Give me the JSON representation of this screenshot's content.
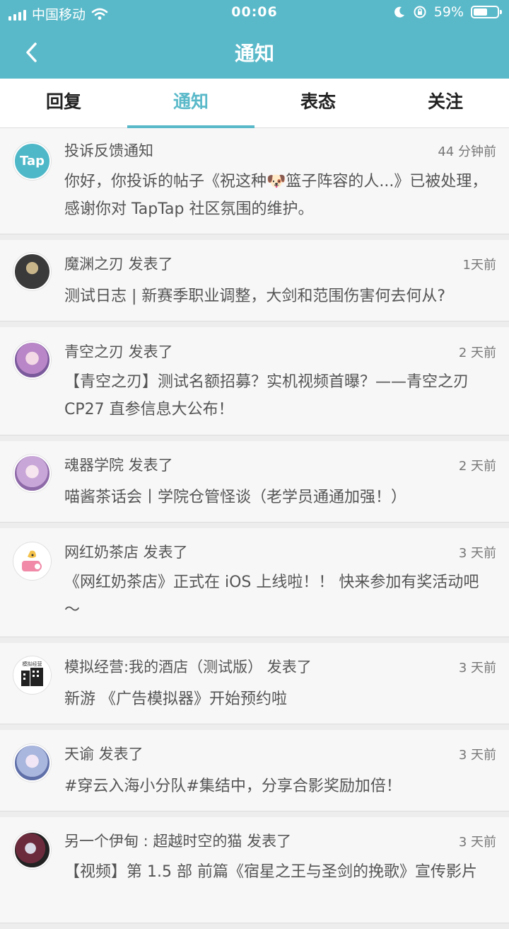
{
  "status": {
    "carrier": "中国移动",
    "time": "00:06",
    "battery": "59%",
    "battery_level": 0.59
  },
  "header": {
    "title": "通知"
  },
  "tabs": [
    {
      "label": "回复"
    },
    {
      "label": "通知"
    },
    {
      "label": "表态"
    },
    {
      "label": "关注"
    }
  ],
  "notifications": [
    {
      "sender": "投诉反馈通知",
      "time": "44 分钟前",
      "body": "你好，你投诉的帖子《祝这种🐶篮子阵容的人...》已被处理，感谢你对 TapTap 社区氛围的维护。",
      "avatar_text": "Tap"
    },
    {
      "sender": "魔渊之刃 发表了",
      "time": "1天前",
      "body": "测试日志 | 新赛季职业调整，大剑和范围伤害何去何从?"
    },
    {
      "sender": "青空之刃 发表了",
      "time": "2 天前",
      "body": "【青空之刃】测试名额招募？实机视频首曝？——青空之刃 CP27 直参信息大公布！"
    },
    {
      "sender": "魂器学院 发表了",
      "time": "2 天前",
      "body": "喵酱茶话会丨学院仓管怪谈（老学员通通加强！）"
    },
    {
      "sender": "网红奶茶店 发表了",
      "time": "3 天前",
      "body": "《网红奶茶店》正式在 iOS 上线啦！！ 快来参加有奖活动吧～"
    },
    {
      "sender": "模拟经营:我的酒店（测试版） 发表了",
      "time": "3 天前",
      "body": "新游 《广告模拟器》开始预约啦",
      "avatar_text": "模拟经营"
    },
    {
      "sender": "天谕 发表了",
      "time": "3 天前",
      "body": "#穿云入海小分队#集结中，分享合影奖励加倍！"
    },
    {
      "sender": "另一个伊甸 : 超越时空的猫 发表了",
      "time": "3 天前",
      "body": "【视频】第 1.5 部 前篇《宿星之王与圣剑的挽歌》宣传影片"
    }
  ]
}
